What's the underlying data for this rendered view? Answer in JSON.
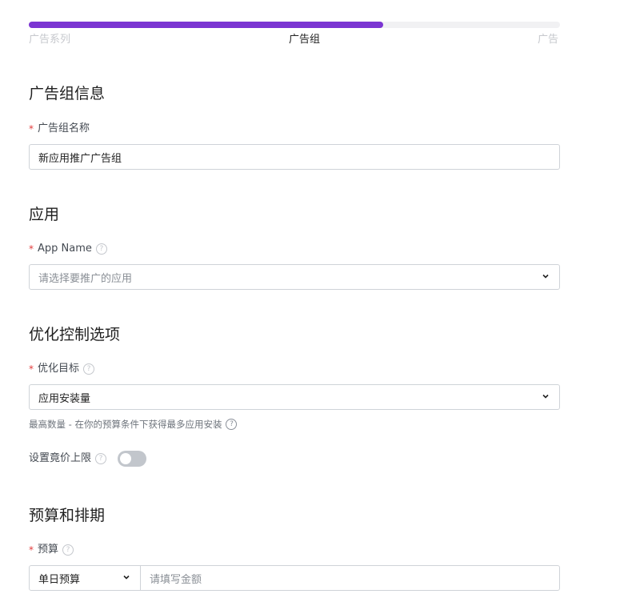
{
  "progress": {
    "fraction": 0.667,
    "steps": [
      "广告系列",
      "广告组",
      "广告"
    ],
    "active_step_index": 1,
    "accent_color": "#7b35d2"
  },
  "sections": {
    "adgroup_info": {
      "title": "广告组信息",
      "name_label": "广告组名称",
      "name_value": "新应用推广广告组"
    },
    "app": {
      "title": "应用",
      "app_label": "App Name",
      "app_placeholder": "请选择要推广的应用"
    },
    "optimization": {
      "title": "优化控制选项",
      "goal_label": "优化目标",
      "goal_value": "应用安装量",
      "goal_hint": "最高数量 - 在你的预算条件下获得最多应用安装",
      "bid_cap_label": "设置竟价上限",
      "bid_cap_enabled": false
    },
    "budget": {
      "title": "预算和排期",
      "budget_label": "预算",
      "budget_type": "单日预算",
      "amount_placeholder": "请填写金额"
    }
  },
  "required_marker": "*",
  "icons": {
    "help": "question-circle-icon",
    "dropdown": "chevron-down-icon"
  },
  "colors": {
    "required": "#e23c3c",
    "toggle_off": "#c2c6cc"
  }
}
